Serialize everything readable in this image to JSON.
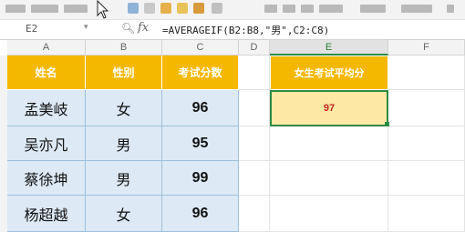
{
  "formula_bar": {
    "cell_ref": "E2",
    "fx": "fx",
    "formula": "=AVERAGEIF(B2:B8,\"男\",C2:C8)"
  },
  "columns": [
    "A",
    "B",
    "C",
    "D",
    "E",
    "F"
  ],
  "table": {
    "headers": [
      "姓名",
      "性别",
      "考试分数"
    ],
    "rows": [
      [
        "孟美岐",
        "女",
        "96"
      ],
      [
        "吴亦凡",
        "男",
        "95"
      ],
      [
        "蔡徐坤",
        "男",
        "99"
      ],
      [
        "杨超越",
        "女",
        "96"
      ]
    ]
  },
  "summary": {
    "header": "女生考试平均分",
    "value": "97"
  },
  "colors": {
    "header_fill": "#f5b800",
    "body_fill": "#dde9f5",
    "result_fill": "#fde8a5",
    "result_text": "#c6251e",
    "selection": "#2e8b45"
  }
}
